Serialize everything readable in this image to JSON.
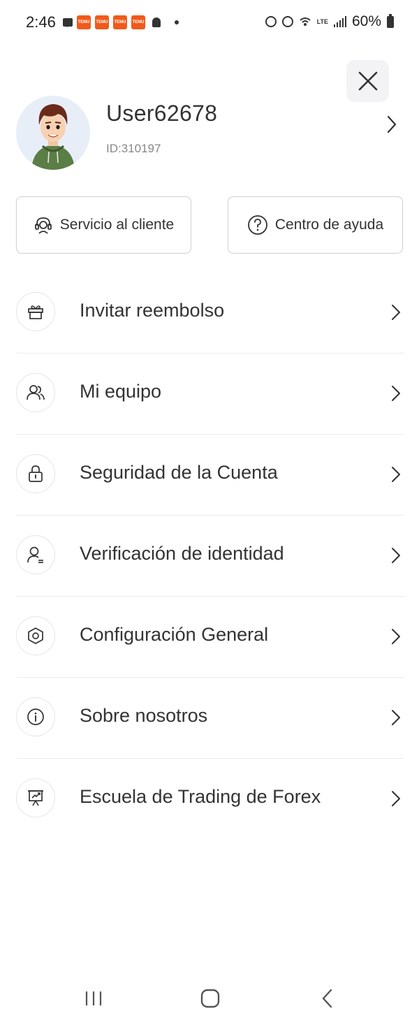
{
  "status_bar": {
    "time": "2:46",
    "temu_badge": "TEMU",
    "temu_color": "#f05a1a",
    "network": "LTE",
    "battery_text": "60%"
  },
  "profile": {
    "username": "User62678",
    "user_id": "ID:310197"
  },
  "quick_actions": {
    "customer_service": "Servicio al cliente",
    "help_center": "Centro de ayuda"
  },
  "menu": {
    "items": [
      {
        "label": "Invitar reembolso",
        "icon": "gift-icon"
      },
      {
        "label": "Mi equipo",
        "icon": "team-icon"
      },
      {
        "label": "Seguridad de la Cuenta",
        "icon": "lock-icon"
      },
      {
        "label": "Verificación de identidad",
        "icon": "id-person-icon"
      },
      {
        "label": "Configuración General",
        "icon": "settings-icon"
      },
      {
        "label": "Sobre nosotros",
        "icon": "info-icon"
      },
      {
        "label": "Escuela de Trading de Forex",
        "icon": "presentation-icon"
      }
    ]
  },
  "colors": {
    "text": "#333333",
    "divider": "#ececef",
    "icon_stroke": "#333333"
  }
}
